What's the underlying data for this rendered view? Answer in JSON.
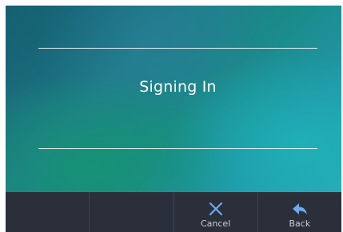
{
  "screen": {
    "status_text": "Signing In"
  },
  "softkeys": [
    {
      "label": "",
      "icon": ""
    },
    {
      "label": "",
      "icon": ""
    },
    {
      "label": "Cancel",
      "icon": "close-icon",
      "color": "#6fa7f2"
    },
    {
      "label": "Back",
      "icon": "back-arrow-icon",
      "color": "#6fa7f2"
    }
  ],
  "colors": {
    "softkey_bar": "#2a2f3a",
    "icon_accent": "#6fa7f2",
    "text": "#ffffff"
  }
}
